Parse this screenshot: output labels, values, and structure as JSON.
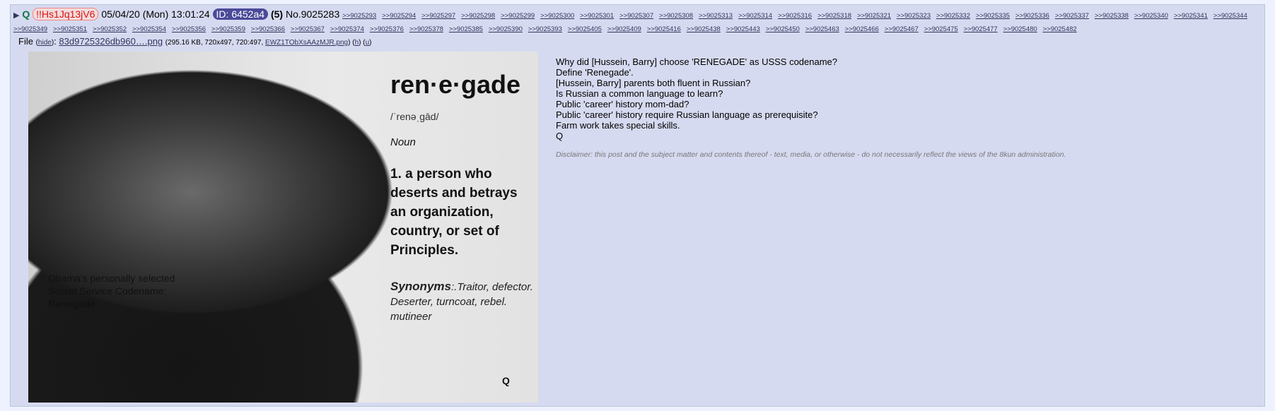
{
  "post": {
    "name": "Q",
    "tripcode": "!!Hs1Jq13jV6",
    "datetime": "05/04/20 (Mon) 13:01:24",
    "id_badge": "ID: 6452a4",
    "id_count": "(5)",
    "post_no": "No.9025283",
    "replies": [
      ">>9025293",
      ">>9025294",
      ">>9025297",
      ">>9025298",
      ">>9025299",
      ">>9025300",
      ">>9025301",
      ">>9025307",
      ">>9025308",
      ">>9025313",
      ">>9025314",
      ">>9025316",
      ">>9025318",
      ">>9025321",
      ">>9025323",
      ">>9025332",
      ">>9025335",
      ">>9025336",
      ">>9025337",
      ">>9025338",
      ">>9025340",
      ">>9025341",
      ">>9025344",
      ">>9025349",
      ">>9025351",
      ">>9025352",
      ">>9025354",
      ">>9025356",
      ">>9025359",
      ">>9025366",
      ">>9025367",
      ">>9025374",
      ">>9025376",
      ">>9025378",
      ">>9025385",
      ">>9025390",
      ">>9025393",
      ">>9025405",
      ">>9025409",
      ">>9025416",
      ">>9025438",
      ">>9025443",
      ">>9025450",
      ">>9025463",
      ">>9025466",
      ">>9025467",
      ">>9025475",
      ">>9025477",
      ">>9025480",
      ">>9025482"
    ]
  },
  "file": {
    "label": "File",
    "hide_link": "hide",
    "filename": "83d9725326db960….png",
    "meta": "(295.16 KB, 720x497, 720:497, ",
    "orig_name": "EWZ1TObXsAAzMJR.png",
    "meta_close": ")",
    "link_h": "h",
    "link_u": "u"
  },
  "image": {
    "word": "ren·e·gade",
    "pronunciation": "/ˈrenəˌgād/",
    "part_of_speech": "Noun",
    "definition": "1. a person who deserts and betrays an organization, country, or set of Principles.",
    "synonyms_label": "Synonyms",
    "synonyms_text": ":.Traitor, defector. Deserter, turncoat, rebel. mutineer",
    "caption_line1": "Obama's personally selected",
    "caption_line2": "Secret Service Codename:",
    "caption_line3": "Renegade",
    "corner_mark": "Q"
  },
  "body": {
    "lines": [
      "Why did [Hussein, Barry] choose 'RENEGADE' as USSS codename?",
      "Define 'Renegade'.",
      "[Hussein, Barry] parents both fluent in Russian?",
      "Is Russian a common language to learn?",
      "Public 'career' history mom-dad?",
      "Public 'career' history require Russian language as prerequisite?",
      "Farm work takes special skills.",
      "Q"
    ],
    "disclaimer": "Disclaimer: this post and the subject matter and contents thereof - text, media, or otherwise - do not necessarily reflect the views of the 8kun administration."
  }
}
